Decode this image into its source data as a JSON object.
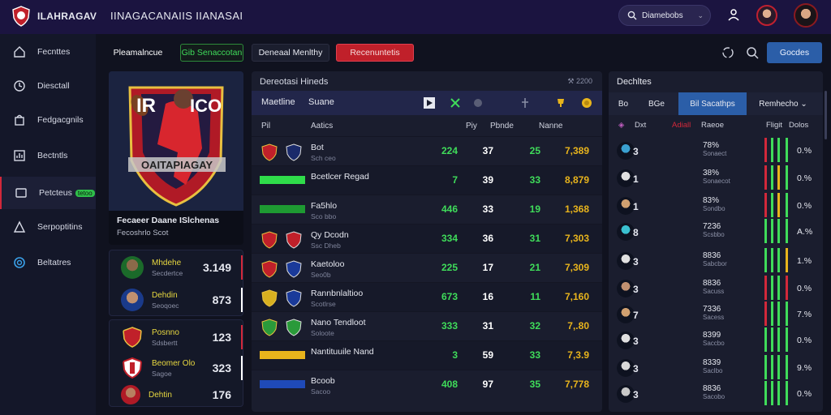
{
  "app": {
    "name": "ILAHRAGAV",
    "heading": "IINAGACANAIIS IIANASAI"
  },
  "search": {
    "label": "Diamebobs"
  },
  "sidebar": {
    "items": [
      {
        "label": "Fecnttes",
        "icon": "home-icon"
      },
      {
        "label": "Diesctall",
        "icon": "clock-icon"
      },
      {
        "label": "Fedgacgnils",
        "icon": "bag-icon"
      },
      {
        "label": "Bectntls",
        "icon": "chart-icon"
      },
      {
        "label": "Petcteus",
        "badge": "tetoo",
        "icon": "card-icon"
      },
      {
        "label": "Serpoptitins",
        "icon": "triangle-icon"
      },
      {
        "label": "Beltatres",
        "icon": "ring-icon"
      }
    ]
  },
  "toolbar": {
    "btn1": "Pleamalncue",
    "btn2": "Gib Senaccotan",
    "btn3": "Deneaal Menlthy",
    "btn4": "Recenuntetis",
    "primary": "Gocdes"
  },
  "hero": {
    "caption": "Fecaeer Daane ISlchenas",
    "sub": "Fecoshrlo Scot",
    "art_text": [
      "IR",
      "ICO",
      "OAITAPIAGAY"
    ]
  },
  "player_cards": [
    [
      {
        "name": "Mhdehe",
        "sub": "Secdertce",
        "value": "3.149",
        "mark": "#d2283a"
      },
      {
        "name": "Dehdin",
        "sub": "Seoqoec",
        "value": "873",
        "mark": "#ffffff"
      }
    ],
    [
      {
        "name": "Posnno",
        "sub": "Sdsbertt",
        "value": "123",
        "mark": "#d2283a"
      },
      {
        "name": "Beomer Olo",
        "sub": "Sagoe",
        "value": "323",
        "mark": "#ffffff"
      },
      {
        "name": "Dehtin",
        "sub": "",
        "value": "176",
        "mark": ""
      }
    ]
  ],
  "center": {
    "title": "Dereotasi Hineds",
    "title_right": "2200",
    "tabs": [
      "Maetline",
      "Suane"
    ],
    "headers": [
      "Pil",
      "Aatics",
      "Piy",
      "Pbnde",
      "Nanne"
    ],
    "rows": [
      {
        "name": "Bot",
        "sub": "Sch ceo",
        "a": "224",
        "b": "37",
        "c": "25",
        "d": "7,389",
        "dark": false,
        "crest1": "#c0202a",
        "crest2": "#1a2a6a"
      },
      {
        "name": "Bcetlcer Regad",
        "sub": "",
        "a": "7",
        "b": "39",
        "c": "33",
        "d": "8,879",
        "dark": true,
        "bar": "#2fdc4a"
      },
      {
        "name": "Fa5hlo",
        "sub": "Sco bbo",
        "a": "446",
        "b": "33",
        "c": "19",
        "d": "1,368",
        "dark": false,
        "bar": "#1e9a32"
      },
      {
        "name": "Qy Dcodn",
        "sub": "Ssc Dheb",
        "a": "334",
        "b": "36",
        "c": "31",
        "d": "7,303",
        "dark": true,
        "crest1": "#c0202a",
        "crest2": "#c0202a"
      },
      {
        "name": "Kaetoloo",
        "sub": "Seo0b",
        "a": "225",
        "b": "17",
        "c": "21",
        "d": "7,309",
        "dark": false,
        "crest1": "#c0202a",
        "crest2": "#1a3a9a"
      },
      {
        "name": "Rannbnlaltioo",
        "sub": "Scotlrse",
        "a": "673",
        "b": "16",
        "c": "11",
        "d": "7,160",
        "dark": true,
        "crest1": "#d8b020",
        "crest2": "#1a3a9a"
      },
      {
        "name": "Nano Tendloot",
        "sub": "Soloote",
        "a": "333",
        "b": "31",
        "c": "32",
        "d": "7,.80",
        "dark": false,
        "crest1": "#2a9a3a",
        "crest2": "#2a9a3a"
      },
      {
        "name": "Nantituuile Nand",
        "sub": "",
        "a": "3",
        "b": "59",
        "c": "33",
        "d": "7,3.9",
        "dark": true,
        "bar": "#e8b41c"
      },
      {
        "name": "Bcoob",
        "sub": "Sacoo",
        "a": "408",
        "b": "97",
        "c": "35",
        "d": "7,778",
        "dark": false,
        "bar": "#1f4ab8"
      }
    ]
  },
  "right": {
    "title": "Dechltes",
    "tabs": [
      "Bo",
      "BGe",
      "Bil Sacathps",
      "Remhecho"
    ],
    "headers": [
      "Dxt",
      "Adiall",
      "Raeoe",
      "Fligit",
      "Dolos"
    ],
    "rows": [
      {
        "rank": "3",
        "pct": "78%",
        "sub": "Sonaect",
        "rate": "0.%"
      },
      {
        "rank": "1",
        "pct": "38%",
        "sub": "Sonaecot",
        "rate": "0.%"
      },
      {
        "rank": "1",
        "pct": "83%",
        "sub": "Sondbo",
        "rate": "0.%"
      },
      {
        "rank": "8",
        "pct": "7236",
        "sub": "Scsbbo",
        "rate": "A.%"
      },
      {
        "rank": "3",
        "pct": "8836",
        "sub": "Sabcbor",
        "rate": "1.%"
      },
      {
        "rank": "3",
        "pct": "8836",
        "sub": "Sacuss",
        "rate": "0.%"
      },
      {
        "rank": "7",
        "pct": "7336",
        "sub": "Sacess",
        "rate": "7.%"
      },
      {
        "rank": "3",
        "pct": "8399",
        "sub": "Saccbo",
        "rate": "0.%"
      },
      {
        "rank": "3",
        "pct": "8339",
        "sub": "Saclbo",
        "rate": "9.%"
      },
      {
        "rank": "3",
        "pct": "8836",
        "sub": "Sacobo",
        "rate": "0.%"
      }
    ]
  },
  "colors": {
    "accent_green": "#3fdc5a",
    "accent_red": "#d2283a",
    "accent_yellow": "#e8b41c",
    "primary": "#2b5ea8"
  }
}
